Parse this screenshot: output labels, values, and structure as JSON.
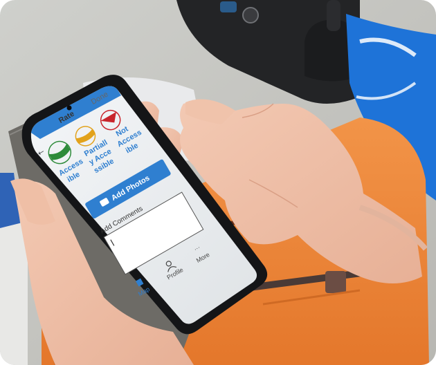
{
  "photo": {
    "description_free": true
  },
  "app": {
    "rate_tab": "Rate",
    "done_tab": "Done",
    "rating_options": [
      {
        "label_lines": [
          "Access",
          "ible"
        ],
        "color": "#2e8b3a"
      },
      {
        "label_lines": [
          "Partiall",
          "y Acce",
          "ssible"
        ],
        "color": "#e2a21b"
      },
      {
        "label_lines": [
          "Not",
          "Access",
          "ible"
        ],
        "color": "#c9252c"
      }
    ],
    "add_photos_label": "Add Photos",
    "add_comments_label": "Add Comments",
    "nav_items": [
      {
        "label": "Map",
        "icon": "map-icon"
      },
      {
        "label": "Profile",
        "icon": "profile-icon"
      },
      {
        "label": "More",
        "icon": "more-icon"
      }
    ],
    "accent_color": "#2f7fd0"
  },
  "colors": {
    "bag_orange": "#f08a3c",
    "jacket_blue": "#1e73d8",
    "phone_case": "#6d6b66",
    "ground": "#c9c8c4"
  }
}
